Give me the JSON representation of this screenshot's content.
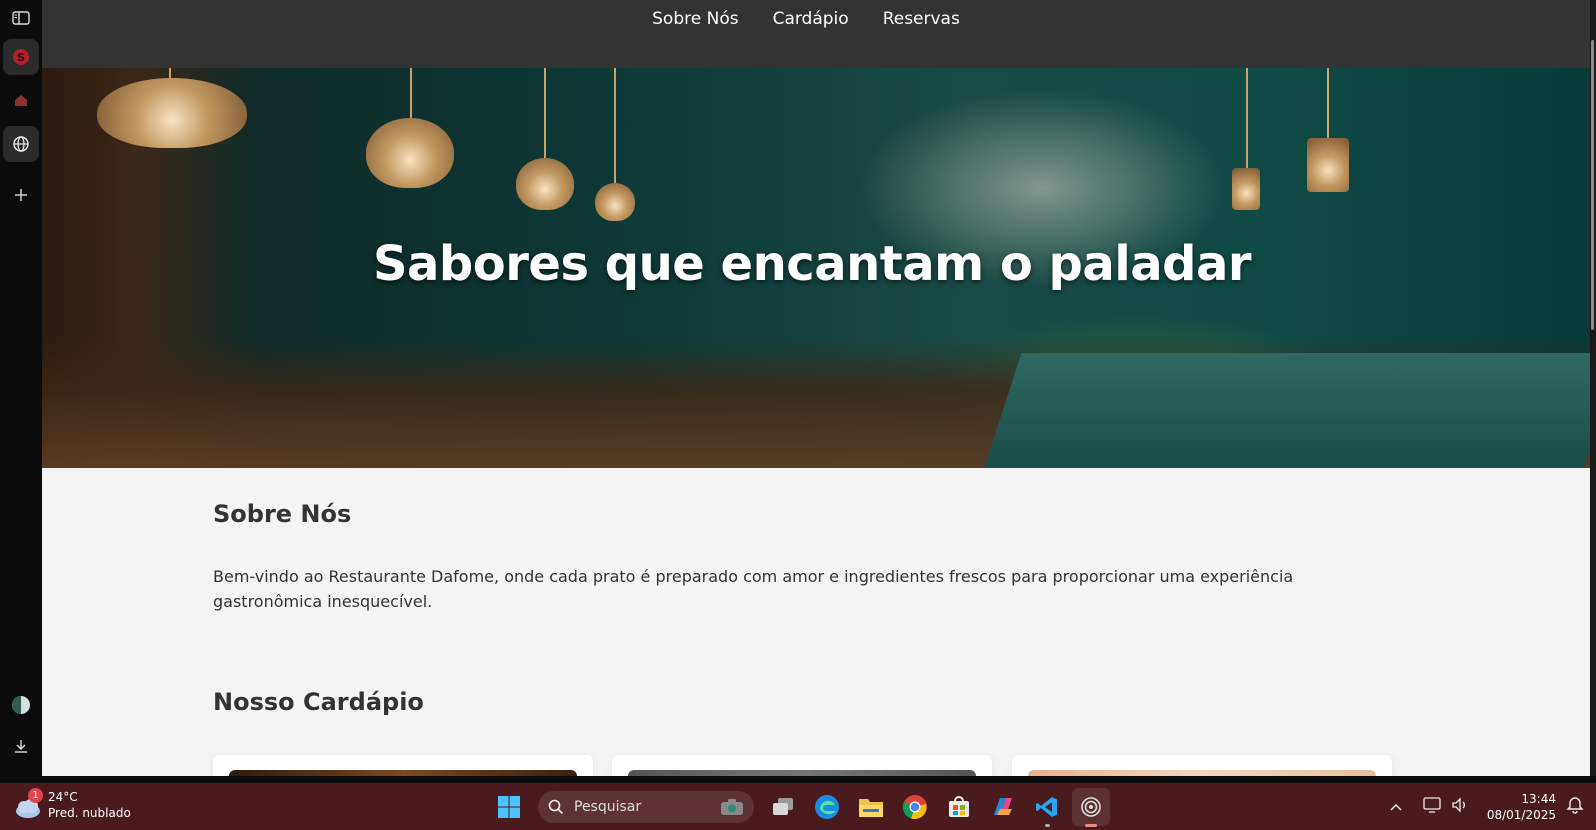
{
  "browser_sidebar": {
    "items": [
      {
        "name": "sidebar-toggle-icon"
      },
      {
        "name": "app-red-icon"
      },
      {
        "name": "house-icon"
      },
      {
        "name": "globe-icon"
      },
      {
        "name": "add-icon"
      },
      {
        "name": "profile-icon"
      },
      {
        "name": "download-icon"
      }
    ]
  },
  "site": {
    "nav": [
      "Sobre Nós",
      "Cardápio",
      "Reservas"
    ],
    "hero_title": "Sabores que encantam o paladar",
    "about": {
      "title": "Sobre Nós",
      "text": "Bem-vindo ao Restaurante Dafome, onde cada prato é preparado com amor e ingredientes frescos para proporcionar uma experiência gastronômica inesquecível."
    },
    "menu": {
      "title": "Nosso Cardápio"
    }
  },
  "taskbar": {
    "weather": {
      "temp": "24°C",
      "condition": "Pred. nublado",
      "badge": "1"
    },
    "search_placeholder": "Pesquisar",
    "apps": [
      "task-view-icon",
      "edge-icon",
      "file-explorer-icon",
      "chrome-icon",
      "store-icon",
      "copilot-icon",
      "vscode-icon",
      "app-circle-icon"
    ],
    "clock": {
      "time": "13:44",
      "date": "08/01/2025"
    }
  },
  "colors": {
    "nav_bg": "#333333",
    "page_bg": "#f4f4f4",
    "taskbar_bg": "#4a1a1e",
    "text": "#333333"
  }
}
